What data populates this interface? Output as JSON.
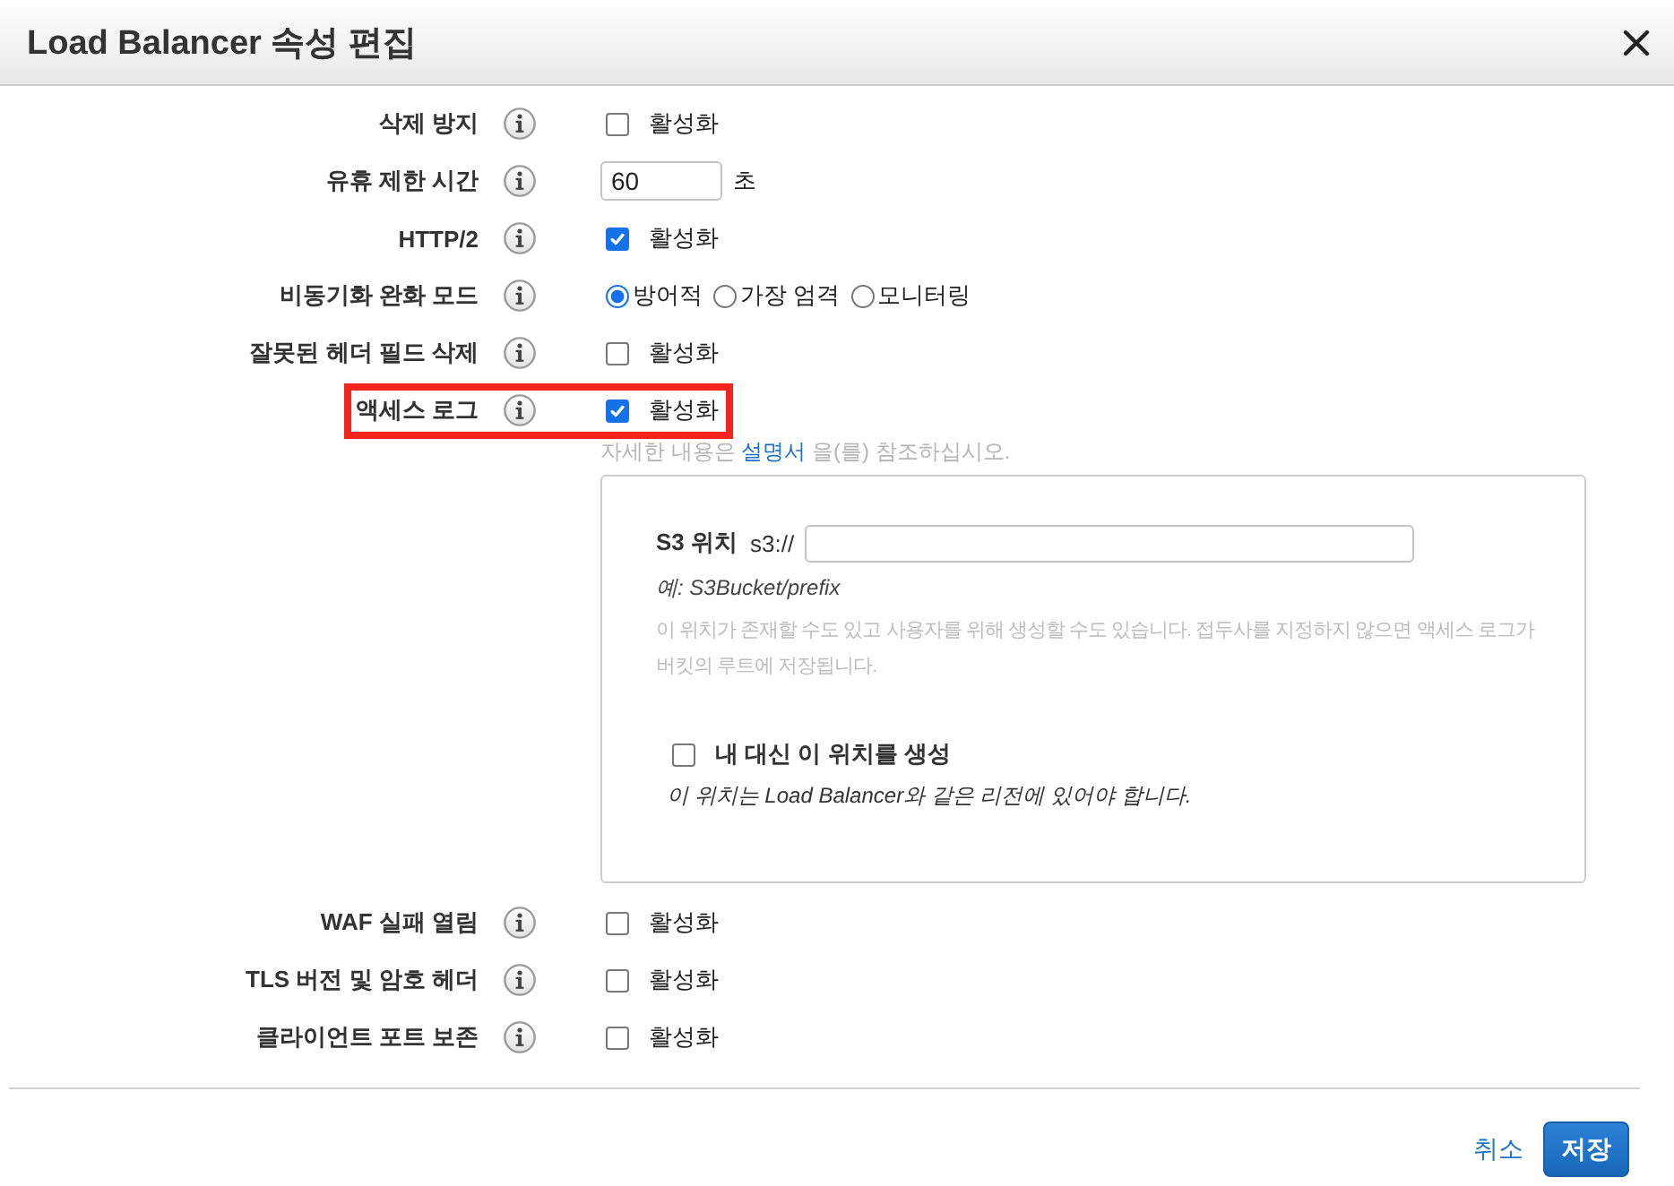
{
  "dialog": {
    "title": "Load Balancer 속성 편집"
  },
  "settings": [
    {
      "kind": "checkbox",
      "label": "삭제 방지",
      "checked": false,
      "option": "활성화",
      "highlighted": false
    },
    {
      "kind": "number",
      "label": "유휴 제한 시간",
      "value": "60",
      "unit": "초",
      "highlighted": false
    },
    {
      "kind": "checkbox",
      "label": "HTTP/2",
      "checked": true,
      "option": "활성화",
      "highlighted": false
    },
    {
      "kind": "radio",
      "label": "비동기화 완화 모드",
      "options": [
        {
          "label": "방어적",
          "selected": true
        },
        {
          "label": "가장 엄격",
          "selected": false
        },
        {
          "label": "모니터링",
          "selected": false
        }
      ],
      "highlighted": false
    },
    {
      "kind": "checkbox",
      "label": "잘못된 헤더 필드 삭제",
      "checked": false,
      "option": "활성화",
      "highlighted": false
    },
    {
      "kind": "checkbox",
      "label": "액세스 로그",
      "checked": true,
      "option": "활성화",
      "highlighted": true,
      "help": {
        "before": "자세한 내용은",
        "link": "설명서",
        "after": "을(를) 참조하십시오."
      },
      "details": {
        "location_label": "S3 위치",
        "prefix": "s3://",
        "example": "예: S3Bucket/prefix",
        "description": "이 위치가 존재할 수도 있고 사용자를 위해 생성할 수도 있습니다. 접두사를 지정하지 않으면 액세스 로그가 버킷의 루트에 저장됩니다.",
        "create_option": {
          "label": "내 대신 이 위치를 생성",
          "checked": false
        },
        "note": "이 위치는 Load Balancer와 같은 리전에 있어야 합니다."
      }
    },
    {
      "kind": "checkbox",
      "label": "WAF 실패 열림",
      "checked": false,
      "option": "활성화",
      "highlighted": false
    },
    {
      "kind": "checkbox",
      "label": "TLS 버전 및 암호 헤더",
      "checked": false,
      "option": "활성화",
      "highlighted": false
    },
    {
      "kind": "checkbox",
      "label": "클라이언트 포트 보존",
      "checked": false,
      "option": "활성화",
      "highlighted": false
    }
  ],
  "buttons": [
    {
      "kind": "link",
      "label": "취소"
    },
    {
      "kind": "primary",
      "label": "저장"
    }
  ]
}
